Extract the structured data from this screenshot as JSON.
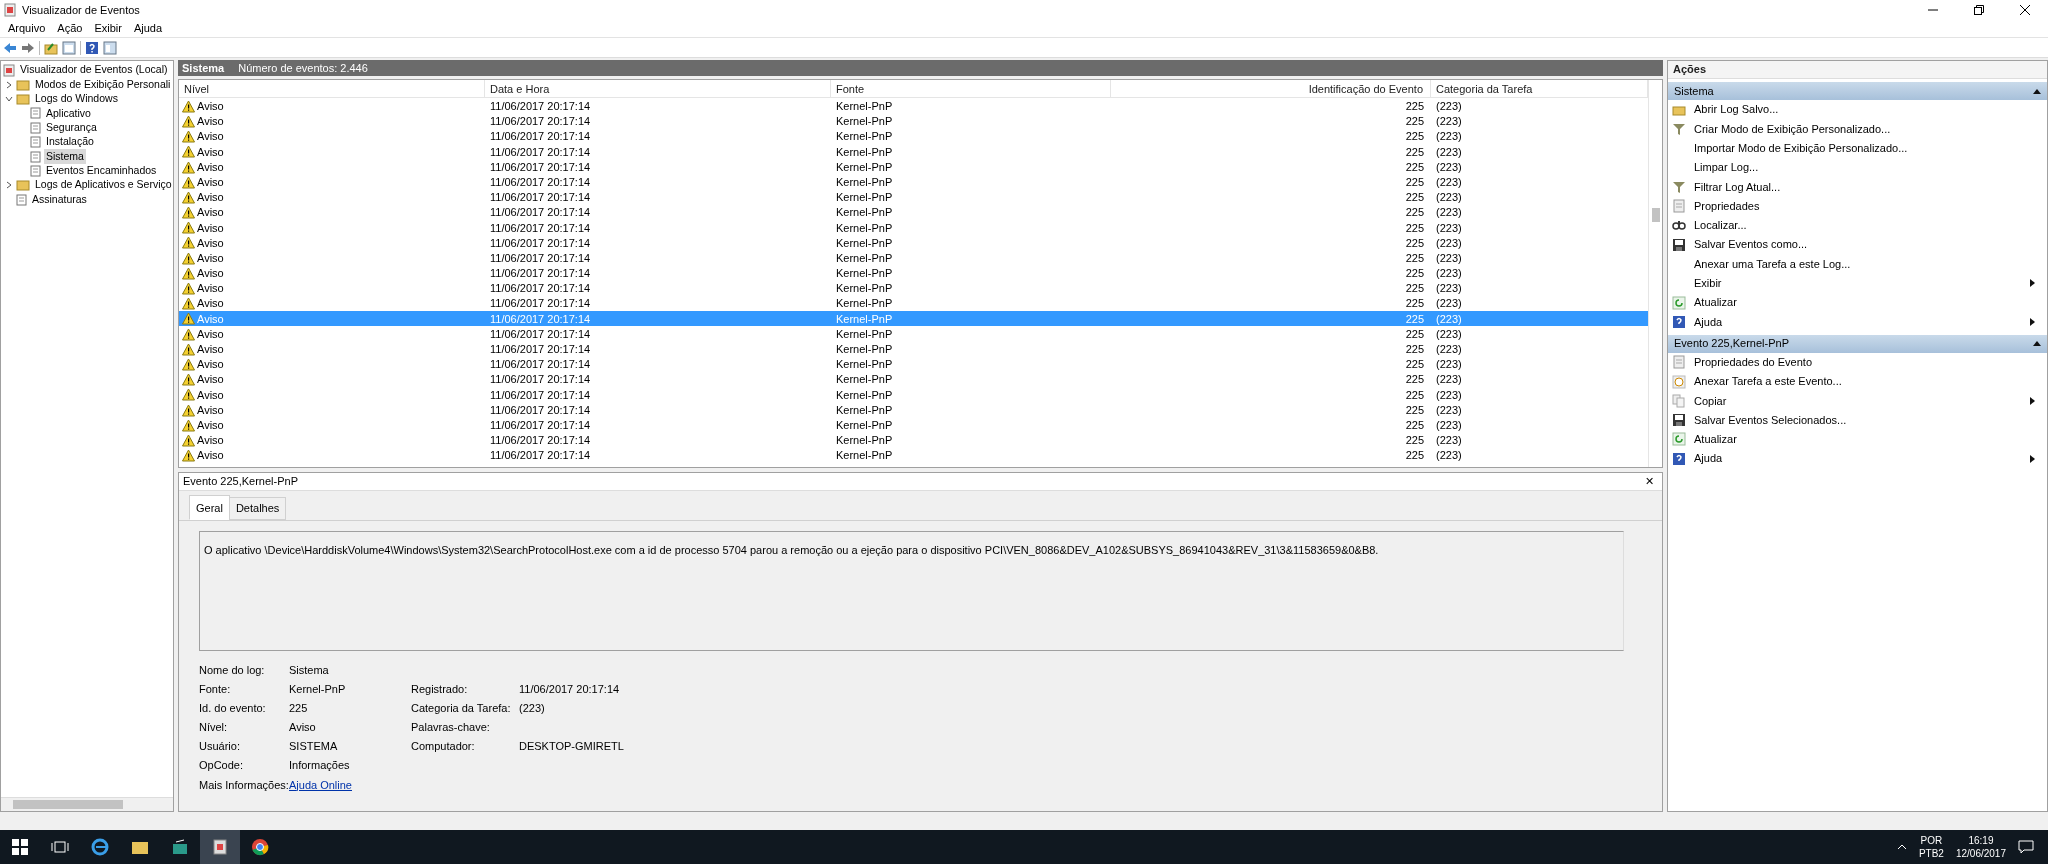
{
  "window": {
    "title": "Visualizador de Eventos"
  },
  "menu": [
    "Arquivo",
    "Ação",
    "Exibir",
    "Ajuda"
  ],
  "tree": [
    {
      "label": "Visualizador de Eventos (Local)",
      "selected": false,
      "children": [
        {
          "label": "Modos de Exibição Personali",
          "expanded": false,
          "selected": false
        },
        {
          "label": "Logs do Windows",
          "expanded": true,
          "selected": false,
          "children": [
            {
              "label": "Aplicativo",
              "selected": false
            },
            {
              "label": "Segurança",
              "selected": false
            },
            {
              "label": "Instalação",
              "selected": false
            },
            {
              "label": "Sistema",
              "selected": true
            },
            {
              "label": "Eventos Encaminhados",
              "selected": false
            }
          ]
        },
        {
          "label": "Logs de Aplicativos e Serviço",
          "expanded": false,
          "selected": false
        },
        {
          "label": "Assinaturas",
          "selected": false
        }
      ]
    }
  ],
  "log_header": {
    "title": "Sistema",
    "count": "Número de eventos: 2.446"
  },
  "table": {
    "columns": [
      "Nível",
      "Data e Hora",
      "Fonte",
      "Identificação do Evento",
      "Categoria da Tarefa"
    ],
    "rows": [
      {
        "level": "Aviso",
        "date": "11/06/2017 20:17:14",
        "source": "Kernel-PnP",
        "event_id": "225",
        "category": "(223)",
        "selected": false
      },
      {
        "level": "Aviso",
        "date": "11/06/2017 20:17:14",
        "source": "Kernel-PnP",
        "event_id": "225",
        "category": "(223)",
        "selected": false
      },
      {
        "level": "Aviso",
        "date": "11/06/2017 20:17:14",
        "source": "Kernel-PnP",
        "event_id": "225",
        "category": "(223)",
        "selected": false
      },
      {
        "level": "Aviso",
        "date": "11/06/2017 20:17:14",
        "source": "Kernel-PnP",
        "event_id": "225",
        "category": "(223)",
        "selected": false
      },
      {
        "level": "Aviso",
        "date": "11/06/2017 20:17:14",
        "source": "Kernel-PnP",
        "event_id": "225",
        "category": "(223)",
        "selected": false
      },
      {
        "level": "Aviso",
        "date": "11/06/2017 20:17:14",
        "source": "Kernel-PnP",
        "event_id": "225",
        "category": "(223)",
        "selected": false
      },
      {
        "level": "Aviso",
        "date": "11/06/2017 20:17:14",
        "source": "Kernel-PnP",
        "event_id": "225",
        "category": "(223)",
        "selected": false
      },
      {
        "level": "Aviso",
        "date": "11/06/2017 20:17:14",
        "source": "Kernel-PnP",
        "event_id": "225",
        "category": "(223)",
        "selected": false
      },
      {
        "level": "Aviso",
        "date": "11/06/2017 20:17:14",
        "source": "Kernel-PnP",
        "event_id": "225",
        "category": "(223)",
        "selected": false
      },
      {
        "level": "Aviso",
        "date": "11/06/2017 20:17:14",
        "source": "Kernel-PnP",
        "event_id": "225",
        "category": "(223)",
        "selected": false
      },
      {
        "level": "Aviso",
        "date": "11/06/2017 20:17:14",
        "source": "Kernel-PnP",
        "event_id": "225",
        "category": "(223)",
        "selected": false
      },
      {
        "level": "Aviso",
        "date": "11/06/2017 20:17:14",
        "source": "Kernel-PnP",
        "event_id": "225",
        "category": "(223)",
        "selected": false
      },
      {
        "level": "Aviso",
        "date": "11/06/2017 20:17:14",
        "source": "Kernel-PnP",
        "event_id": "225",
        "category": "(223)",
        "selected": false
      },
      {
        "level": "Aviso",
        "date": "11/06/2017 20:17:14",
        "source": "Kernel-PnP",
        "event_id": "225",
        "category": "(223)",
        "selected": false
      },
      {
        "level": "Aviso",
        "date": "11/06/2017 20:17:14",
        "source": "Kernel-PnP",
        "event_id": "225",
        "category": "(223)",
        "selected": true
      },
      {
        "level": "Aviso",
        "date": "11/06/2017 20:17:14",
        "source": "Kernel-PnP",
        "event_id": "225",
        "category": "(223)",
        "selected": false
      },
      {
        "level": "Aviso",
        "date": "11/06/2017 20:17:14",
        "source": "Kernel-PnP",
        "event_id": "225",
        "category": "(223)",
        "selected": false
      },
      {
        "level": "Aviso",
        "date": "11/06/2017 20:17:14",
        "source": "Kernel-PnP",
        "event_id": "225",
        "category": "(223)",
        "selected": false
      },
      {
        "level": "Aviso",
        "date": "11/06/2017 20:17:14",
        "source": "Kernel-PnP",
        "event_id": "225",
        "category": "(223)",
        "selected": false
      },
      {
        "level": "Aviso",
        "date": "11/06/2017 20:17:14",
        "source": "Kernel-PnP",
        "event_id": "225",
        "category": "(223)",
        "selected": false
      },
      {
        "level": "Aviso",
        "date": "11/06/2017 20:17:14",
        "source": "Kernel-PnP",
        "event_id": "225",
        "category": "(223)",
        "selected": false
      },
      {
        "level": "Aviso",
        "date": "11/06/2017 20:17:14",
        "source": "Kernel-PnP",
        "event_id": "225",
        "category": "(223)",
        "selected": false
      },
      {
        "level": "Aviso",
        "date": "11/06/2017 20:17:14",
        "source": "Kernel-PnP",
        "event_id": "225",
        "category": "(223)",
        "selected": false
      },
      {
        "level": "Aviso",
        "date": "11/06/2017 20:17:14",
        "source": "Kernel-PnP",
        "event_id": "225",
        "category": "(223)",
        "selected": false
      }
    ]
  },
  "details": {
    "title": "Evento 225,Kernel-PnP",
    "close": "✕",
    "tabs": [
      {
        "label": "Geral",
        "selected": true
      },
      {
        "label": "Detalhes",
        "selected": false
      }
    ],
    "message": "O aplicativo \\Device\\HarddiskVolume4\\Windows\\System32\\SearchProtocolHost.exe com a id de processo 5704 parou a remoção ou a ejeção para o dispositivo PCI\\VEN_8086&DEV_A102&SUBSYS_86941043&REV_31\\3&11583659&0&B8.",
    "fields": [
      {
        "label": "Nome do log:",
        "value": "Sistema"
      },
      {
        "label": "Fonte:",
        "value": "Kernel-PnP",
        "label_2": "Registrado:",
        "value_2": "11/06/2017 20:17:14"
      },
      {
        "label": "Id. do evento:",
        "value": "225",
        "label_2": "Categoria da Tarefa:",
        "value_2": "(223)"
      },
      {
        "label": "Nível:",
        "value": "Aviso",
        "label_2": "Palavras-chave:"
      },
      {
        "label": "Usuário:",
        "value": "SISTEMA",
        "label_2": "Computador:",
        "value_2": "DESKTOP-GMIRETL"
      },
      {
        "label": "OpCode:",
        "value": "Informações"
      },
      {
        "label": "Mais Informações:",
        "link": "Ajuda Online"
      }
    ]
  },
  "actions": {
    "title": "Ações",
    "sections": [
      {
        "title": "Sistema",
        "items": [
          {
            "label": "Abrir Log Salvo...",
            "submenu": false
          },
          {
            "label": "Criar Modo de Exibição Personalizado...",
            "submenu": false
          },
          {
            "label": "Importar Modo de Exibição Personalizado...",
            "submenu": false
          },
          {
            "label": "Limpar Log...",
            "submenu": false
          },
          {
            "label": "Filtrar Log Atual...",
            "submenu": false
          },
          {
            "label": "Propriedades",
            "submenu": false
          },
          {
            "label": "Localizar...",
            "submenu": false
          },
          {
            "label": "Salvar Eventos como...",
            "submenu": false
          },
          {
            "label": "Anexar uma Tarefa a este Log...",
            "submenu": false
          },
          {
            "label": "Exibir",
            "submenu": true
          },
          {
            "label": "Atualizar",
            "submenu": false
          },
          {
            "label": "Ajuda",
            "submenu": true
          }
        ]
      },
      {
        "title": "Evento 225,Kernel-PnP",
        "items": [
          {
            "label": "Propriedades do Evento",
            "submenu": false
          },
          {
            "label": "Anexar Tarefa a este Evento...",
            "submenu": false
          },
          {
            "label": "Copiar",
            "submenu": true
          },
          {
            "label": "Salvar Eventos Selecionados...",
            "submenu": false
          },
          {
            "label": "Atualizar",
            "submenu": false
          },
          {
            "label": "Ajuda",
            "submenu": true
          }
        ]
      }
    ]
  },
  "taskbar": {
    "language": "POR",
    "layout": "PTB2",
    "time": "16:19",
    "date": "12/06/2017"
  }
}
